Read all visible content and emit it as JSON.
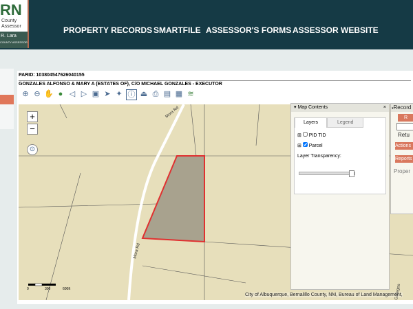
{
  "header": {
    "logo": {
      "mark": "RN",
      "line1": "County",
      "line2": "Assessor",
      "name": "R. Lara",
      "subtitle": "COUNTY ASSESSOR"
    },
    "nav": [
      {
        "label": "PROPERTY RECORDS"
      },
      {
        "label": "SMARTFILE"
      },
      {
        "label": "ASSESSOR'S FORMS"
      },
      {
        "label": "ASSESSOR WEBSITE"
      }
    ]
  },
  "parcel": {
    "parid": "PARID: 103804547626040155",
    "owner": "GONZALES ALFONSO & MARY A (ESTATES OF), C/O MICHAEL GONZALES - EXECUTOR"
  },
  "toolbar": [
    "zoom-in",
    "zoom-out",
    "pan",
    "full-extent",
    "previous-extent",
    "next-extent",
    "select",
    "select-arrow",
    "measure",
    "identify",
    "buffer",
    "print",
    "export",
    "map-print",
    "layers"
  ],
  "map": {
    "zoom_in": "+",
    "zoom_out": "−",
    "roads": [
      "Mora Rd",
      "Mora Rd",
      "Gallegos"
    ],
    "scale": [
      "0",
      "300",
      "600ft"
    ],
    "attribution": "City of Albuquerque, Bernalillo County, NM, Bureau of Land Management,",
    "map_contents": {
      "title": "Map Contents",
      "close": "×",
      "tabs": [
        "Layers",
        "Legend"
      ],
      "layers": [
        {
          "label": "PID TID",
          "checked": false
        },
        {
          "label": "Parcel",
          "checked": true
        }
      ],
      "transparency_label": "Layer Transparency:",
      "transparency": 0.9
    },
    "record": {
      "title": "Record",
      "button": "R",
      "return": "Retu",
      "actions": "Actions",
      "reports": "Reports",
      "property": "Proper"
    }
  },
  "colors": {
    "header": "#153a45",
    "accent": "#e0775a",
    "parcel_outline": "#e03030"
  }
}
